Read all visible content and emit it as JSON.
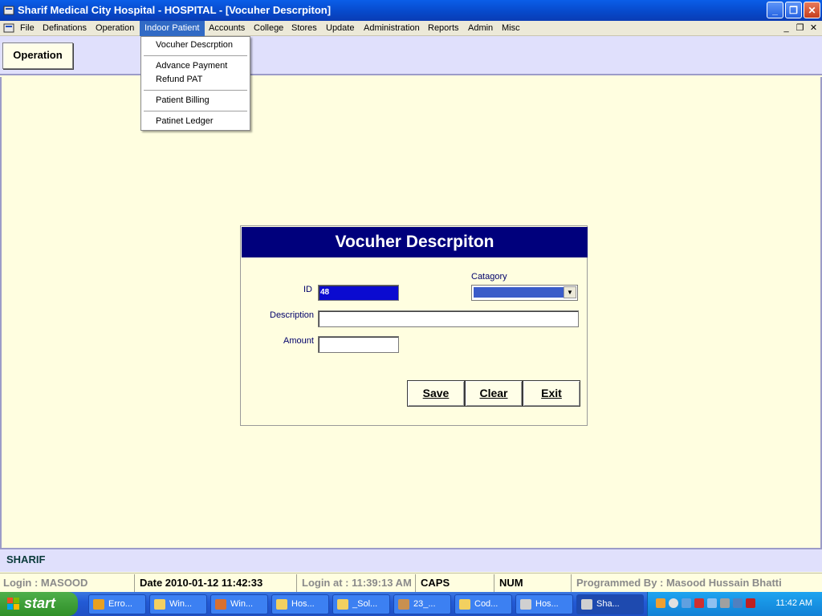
{
  "window": {
    "title": "Sharif Medical City Hospital - HOSPITAL - [Vocuher Descrpiton]",
    "minimize_glyph": "_",
    "restore_glyph": "❐",
    "close_glyph": "✕",
    "mdi_minimize_glyph": "_",
    "mdi_restore_glyph": "❐",
    "mdi_close_glyph": "✕"
  },
  "menu": {
    "items": [
      "File",
      "Definations",
      "Operation",
      "Indoor Patient",
      "Accounts",
      "College",
      "Stores",
      "Update",
      "Administration",
      "Reports",
      "Admin",
      "Misc"
    ],
    "active": "Indoor Patient"
  },
  "dropdown": {
    "items": [
      "Vocuher Descrption",
      "Advance Payment",
      "Refund PAT",
      "Patient Billing",
      "Patinet Ledger"
    ]
  },
  "toolbar": {
    "operation_label": "Operation"
  },
  "dialog": {
    "title": "Vocuher Descrpiton",
    "id_label": "ID",
    "id_value": "48",
    "category_label": "Catagory",
    "description_label": "Description",
    "amount_label": "Amount",
    "save_label": "Save",
    "clear_label": "Clear",
    "exit_label": "Exit"
  },
  "company": {
    "name": "SHARIF"
  },
  "status": {
    "login": "Login :  MASOOD",
    "date": "Date 2010-01-12 11:42:33",
    "login_at": "Login at : 11:39:13 AM",
    "caps": "CAPS",
    "num": "NUM",
    "programmed_by": "Programmed By : Masood Hussain Bhatti"
  },
  "taskbar": {
    "start_label": "start",
    "tasks": [
      "Erro...",
      "Win...",
      "Win...",
      "Hos...",
      "_Sol...",
      "23_...",
      "Cod...",
      "Hos...",
      "Sha..."
    ],
    "clock": "11:42 AM"
  },
  "colors": {
    "background": "#FFFEE0",
    "dialog_header": "#00007C",
    "toolbar_strip": "#E0E0FC",
    "menu_active": "#316AC5"
  }
}
